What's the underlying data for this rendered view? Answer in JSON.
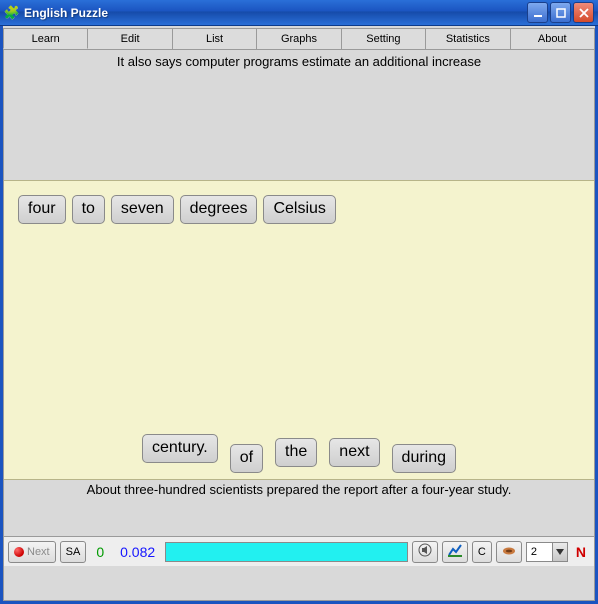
{
  "window": {
    "title": "English Puzzle"
  },
  "tabs": [
    "Learn",
    "Edit",
    "List",
    "Graphs",
    "Setting",
    "Statistics",
    "About"
  ],
  "active_tab_index": 0,
  "prompt_top": "It also says computer programs estimate an additional increase",
  "placed_words": [
    "four",
    "to",
    "seven",
    "degrees",
    "Celsius"
  ],
  "pool_words": [
    "century.",
    "of",
    "the",
    "next",
    "during"
  ],
  "prompt_bottom": "About three-hundred scientists prepared the report after a four-year study.",
  "statusbar": {
    "next_label": "Next",
    "sa_label": "SA",
    "count": "0",
    "time": "0.082",
    "c_label": "C",
    "spin_value": "2",
    "n_label": "N"
  }
}
